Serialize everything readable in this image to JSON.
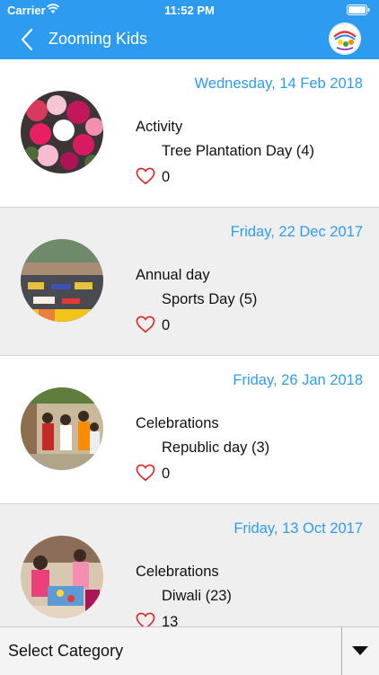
{
  "status_bar": {
    "carrier": "Carrier",
    "time": "11:52 PM"
  },
  "nav": {
    "title": "Zooming Kids"
  },
  "posts": [
    {
      "date": "Wednesday, 14 Feb 2018",
      "category": "Activity",
      "event": "Tree Plantation Day (4)",
      "likes": "0"
    },
    {
      "date": "Friday, 22 Dec 2017",
      "category": "Annual day",
      "event": "Sports Day (5)",
      "likes": "0"
    },
    {
      "date": "Friday, 26 Jan 2018",
      "category": "Celebrations",
      "event": "Republic day (3)",
      "likes": "0"
    },
    {
      "date": "Friday, 13 Oct 2017",
      "category": "Celebrations",
      "event": "Diwali (23)",
      "likes": "13"
    }
  ],
  "category_select": {
    "label": "Select Category"
  },
  "colors": {
    "accent": "#2d9cf0",
    "like": "#e02424",
    "row_alt": "#efefef"
  },
  "icons": [
    "wifi-icon",
    "battery-icon",
    "back-icon",
    "heart-icon",
    "chevron-down-icon"
  ]
}
